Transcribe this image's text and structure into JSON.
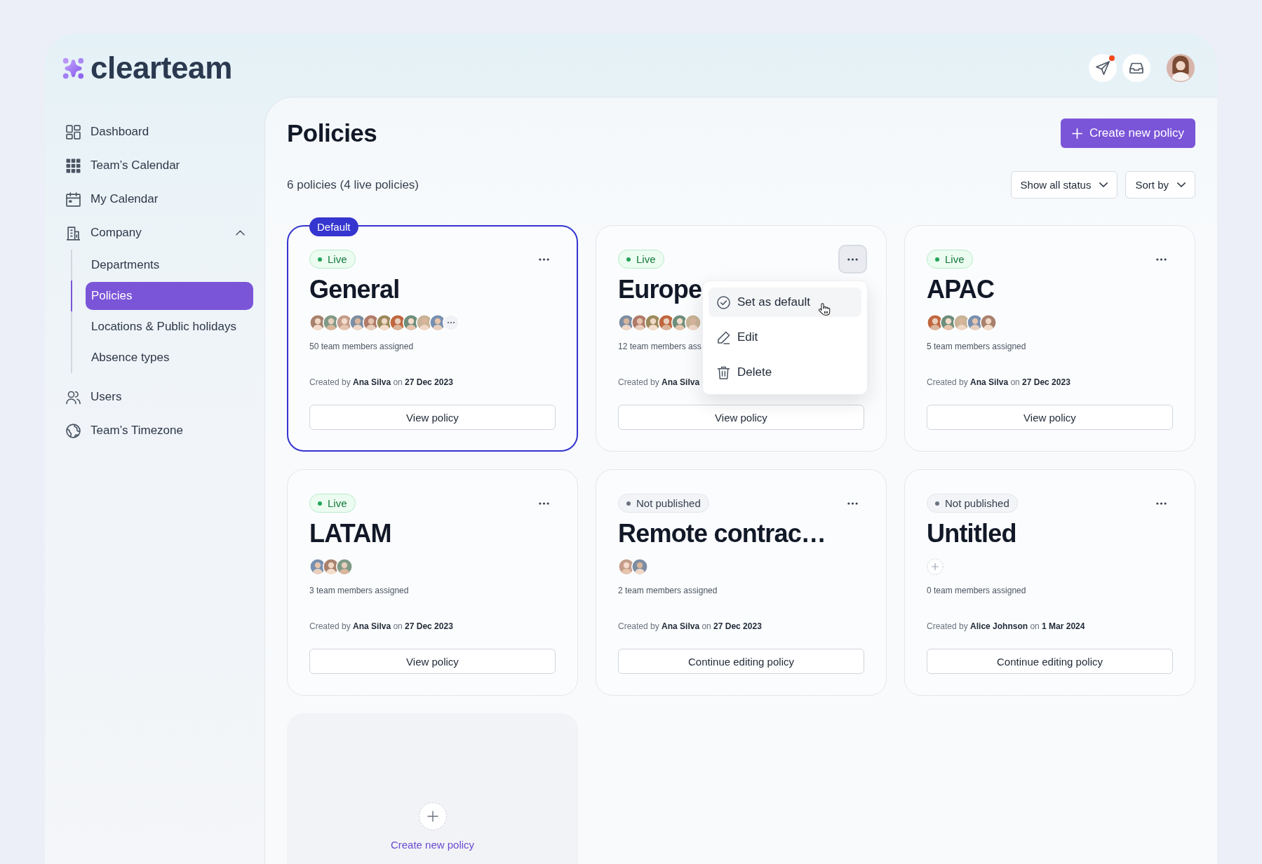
{
  "header": {
    "logo": "clearteam",
    "actions": [
      {
        "unread": true
      },
      {
        "unread": false
      }
    ]
  },
  "sidebar": {
    "items": [
      {
        "label": "Dashboard",
        "selected": false
      },
      {
        "label": "Team’s Calendar",
        "selected": false
      },
      {
        "label": "My Calendar",
        "selected": false
      },
      {
        "label": "Company",
        "selected": false,
        "expanded": true,
        "children": [
          {
            "label": "Departments",
            "selected": false
          },
          {
            "label": "Policies",
            "selected": true
          },
          {
            "label": "Locations & Public holidays",
            "selected": false
          },
          {
            "label": "Absence types",
            "selected": false
          }
        ]
      },
      {
        "label": "Users",
        "selected": false
      },
      {
        "label": "Team’s Timezone",
        "selected": false
      }
    ]
  },
  "page": {
    "title": "Policies",
    "create_button": "Create new policy",
    "summary": "6 policies (4 live policies)",
    "filters": [
      "Show all status",
      "Sort by"
    ]
  },
  "policies": [
    {
      "status": {
        "label": "Live",
        "kind": "live"
      },
      "title": "General",
      "is_default": true,
      "default_badge": "Default",
      "menu_open": false,
      "avatars": [
        {
          "kind": "photo"
        },
        {
          "kind": "photo"
        },
        {
          "kind": "photo"
        },
        {
          "kind": "photo"
        },
        {
          "kind": "photo"
        },
        {
          "kind": "photo"
        },
        {
          "kind": "photo"
        },
        {
          "kind": "photo"
        },
        {
          "kind": "photo"
        },
        {
          "kind": "photo"
        },
        {
          "kind": "more"
        }
      ],
      "members": "50 team members assigned",
      "created": "Created by **Ana Silva** on **27 Dec 2023**",
      "action": "View policy"
    },
    {
      "status": {
        "label": "Live",
        "kind": "live"
      },
      "title": "Europe",
      "is_default": false,
      "menu_open": true,
      "menu": [
        {
          "label": "Set as default",
          "highlighted": true
        },
        {
          "label": "Edit",
          "highlighted": false
        },
        {
          "label": "Delete",
          "highlighted": false
        }
      ],
      "avatars": [
        {
          "kind": "photo"
        },
        {
          "kind": "photo"
        },
        {
          "kind": "photo"
        },
        {
          "kind": "photo"
        },
        {
          "kind": "photo"
        },
        {
          "kind": "photo"
        }
      ],
      "members": "12 team members ass",
      "created": "Created by **Ana Silva**",
      "action": "View policy"
    },
    {
      "status": {
        "label": "Live",
        "kind": "live"
      },
      "title": "APAC",
      "is_default": false,
      "menu_open": false,
      "avatars": [
        {
          "kind": "photo"
        },
        {
          "kind": "photo"
        },
        {
          "kind": "photo"
        },
        {
          "kind": "photo"
        },
        {
          "kind": "photo"
        }
      ],
      "members": "5 team members assigned",
      "created": "Created by **Ana Silva** on **27 Dec 2023**",
      "action": "View policy"
    },
    {
      "status": {
        "label": "Live",
        "kind": "live"
      },
      "title": "LATAM",
      "is_default": false,
      "menu_open": false,
      "avatars": [
        {
          "kind": "photo"
        },
        {
          "kind": "photo"
        },
        {
          "kind": "photo"
        }
      ],
      "members": "3 team members assigned",
      "created": "Created by **Ana Silva** on **27 Dec 2023**",
      "action": "View policy"
    },
    {
      "status": {
        "label": "Not published",
        "kind": "draft"
      },
      "title": "Remote contrac…",
      "is_default": false,
      "menu_open": false,
      "avatars": [
        {
          "kind": "photo"
        },
        {
          "kind": "photo"
        }
      ],
      "members": "2 team members assigned",
      "created": "Created by **Ana Silva** on **27 Dec 2023**",
      "action": "Continue editing policy"
    },
    {
      "status": {
        "label": "Not published",
        "kind": "draft"
      },
      "title": "Untitled",
      "is_default": false,
      "menu_open": false,
      "avatars": [
        {
          "kind": "add"
        }
      ],
      "members": "0 team members assigned",
      "created": "Created by **Alice Johnson** on **1 Mar 2024**",
      "action": "Continue editing policy"
    }
  ],
  "new_policy_card": {
    "label": "Create new policy"
  }
}
